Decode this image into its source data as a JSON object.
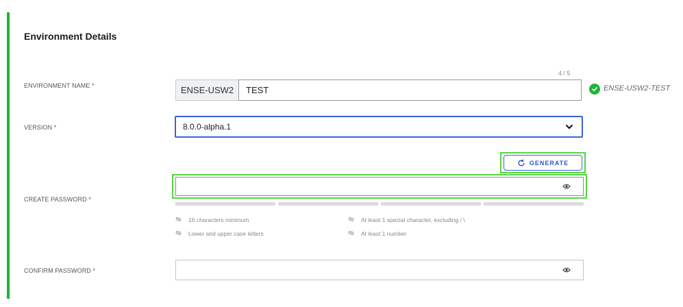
{
  "section": {
    "title": "Environment Details"
  },
  "env_name": {
    "label": "ENVIRONMENT NAME *",
    "char_count": "4 / 5",
    "prefix": "ENSE-USW2",
    "value": "TEST",
    "result": "ENSE-USW2-TEST"
  },
  "version": {
    "label": "VERSION *",
    "selected": "8.0.0-alpha.1"
  },
  "password": {
    "generate_label": "GENERATE",
    "label": "CREATE PASSWORD *",
    "value": "",
    "strength_segments_filled": 0,
    "requirements": [
      "16 characters minimum",
      "At least 1 special character, excluding / \\",
      "Lower and upper case letters",
      "At least 1 number"
    ]
  },
  "confirm": {
    "label": "CONFIRM PASSWORD *",
    "value": ""
  },
  "colors": {
    "accent_green": "#1db53a",
    "focus_blue": "#3a63d8",
    "highlight_green": "#55d63d"
  },
  "icons": [
    "check-circle-icon",
    "chevron-down-icon",
    "refresh-icon",
    "eye-icon",
    "eye-off-icon"
  ]
}
